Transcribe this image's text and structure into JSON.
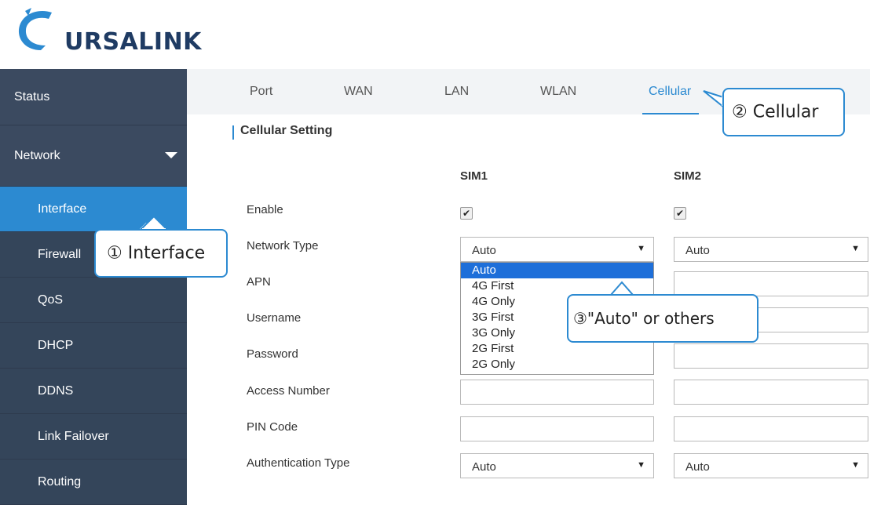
{
  "brand": {
    "logo_text": "URSALINK",
    "accent": "#2c8ad1",
    "sidebar_bg": "#3b4a60",
    "dark_blue": "#1f3b63"
  },
  "sidebar": {
    "items": [
      {
        "label": "Status"
      },
      {
        "label": "Network"
      },
      {
        "label": "Interface"
      },
      {
        "label": "Firewall"
      },
      {
        "label": "QoS"
      },
      {
        "label": "DHCP"
      },
      {
        "label": "DDNS"
      },
      {
        "label": "Link Failover"
      },
      {
        "label": "Routing"
      }
    ]
  },
  "tabs": [
    {
      "label": "Port"
    },
    {
      "label": "WAN"
    },
    {
      "label": "LAN"
    },
    {
      "label": "WLAN"
    },
    {
      "label": "Cellular"
    }
  ],
  "section": {
    "title": "Cellular Setting"
  },
  "columns": {
    "sim1": "SIM1",
    "sim2": "SIM2"
  },
  "form": {
    "enable": "Enable",
    "network_type": "Network Type",
    "apn": "APN",
    "username": "Username",
    "password": "Password",
    "access_number": "Access Number",
    "pin_code": "PIN Code",
    "auth_type": "Authentication Type"
  },
  "values": {
    "sim1_network_type": "Auto",
    "sim2_network_type": "Auto",
    "sim1_auth_type": "Auto",
    "sim2_auth_type": "Auto"
  },
  "dropdown": {
    "options": [
      "Auto",
      "4G First",
      "4G Only",
      "3G First",
      "3G Only",
      "2G First",
      "2G Only"
    ]
  },
  "callouts": {
    "interface": "① Interface",
    "cellular": "② Cellular",
    "auto": "③\"Auto\" or others"
  },
  "icons": {
    "dropdown_arrow": "▼",
    "checkmark": "✔",
    "caret": "caret-down-icon"
  }
}
